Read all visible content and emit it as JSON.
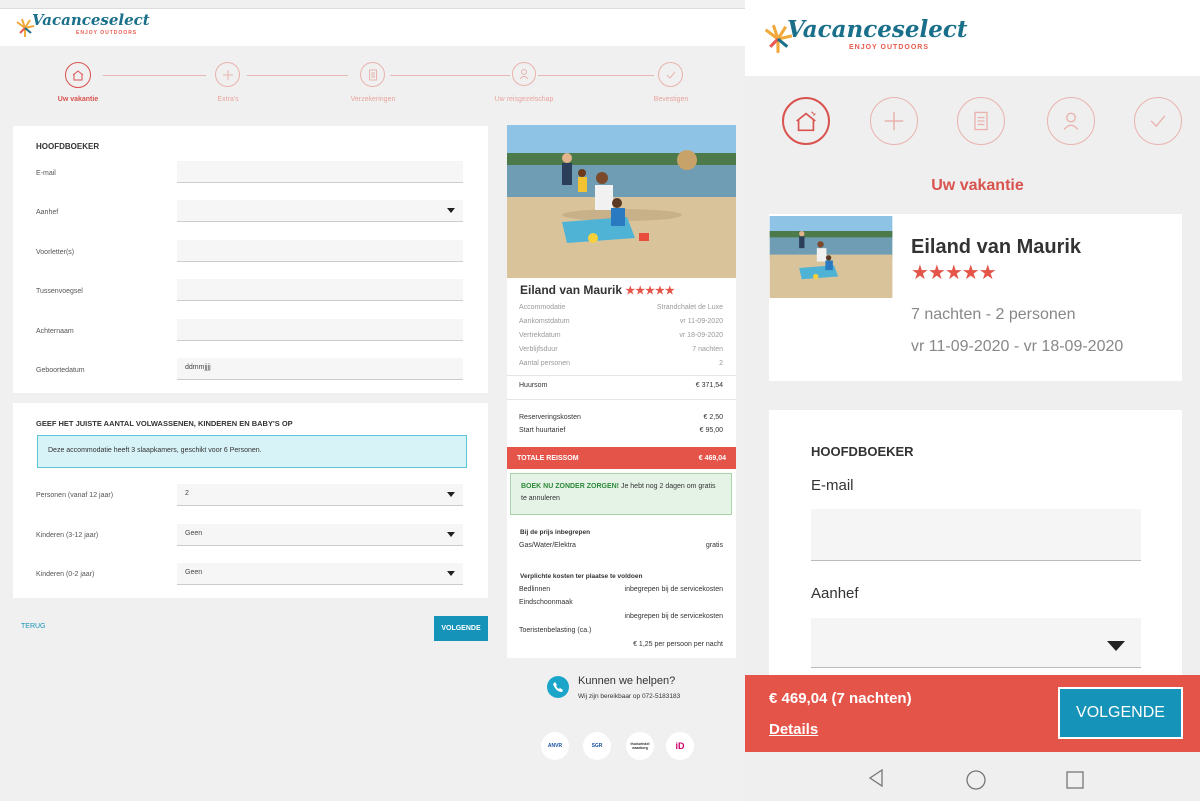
{
  "brand": {
    "name": "Vacanceselect",
    "tagline": "ENJOY OUTDOORS"
  },
  "steps": [
    {
      "label": "Uw vakantie",
      "icon": "house-icon",
      "active": true
    },
    {
      "label": "Extra's",
      "icon": "plus-icon",
      "active": false
    },
    {
      "label": "Verzekeringen",
      "icon": "document-icon",
      "active": false
    },
    {
      "label": "Uw reisgezelschap",
      "icon": "person-icon",
      "active": false
    },
    {
      "label": "Bevestigen",
      "icon": "checkmark-icon",
      "active": false
    }
  ],
  "form": {
    "title": "HOOFDBOEKER",
    "fields": [
      {
        "label": "E-mail",
        "value": ""
      },
      {
        "label": "Aanhef",
        "value": "",
        "type": "select"
      },
      {
        "label": "Voorletter(s)",
        "value": ""
      },
      {
        "label": "Tussenvoegsel",
        "value": ""
      },
      {
        "label": "Achternaam",
        "value": ""
      },
      {
        "label": "Geboortedatum",
        "value": "ddmmjjjj"
      }
    ]
  },
  "guests": {
    "title": "GEEF HET JUISTE AANTAL VOLWASSENEN, KINDEREN EN BABY'S OP",
    "info": "Deze accommodatie heeft 3 slaapkamers, geschikt voor 6 Personen.",
    "rows": [
      {
        "label": "Personen (vanaf 12 jaar)",
        "value": "2"
      },
      {
        "label": "Kinderen (3-12 jaar)",
        "value": "Geen"
      },
      {
        "label": "Kinderen (0-2 jaar)",
        "value": "Geen"
      }
    ]
  },
  "nav": {
    "back": "TERUG",
    "next": "VOLGENDE"
  },
  "summary": {
    "park": "Eiland van Maurik",
    "stars": "★★★★★",
    "details": [
      {
        "label": "Accommodatie",
        "value": "Strandchalet de Luxe"
      },
      {
        "label": "Aankomstdatum",
        "value": "vr 11-09-2020"
      },
      {
        "label": "Vertrekdatum",
        "value": "vr 18-09-2020"
      },
      {
        "label": "Verblijfsduur",
        "value": "7 nachten"
      },
      {
        "label": "Aantal personen",
        "value": "2"
      }
    ],
    "huursom": {
      "label": "Huursom",
      "value": "€ 371,54"
    },
    "costs": [
      {
        "label": "Reserveringskosten",
        "value": "€ 2,50"
      },
      {
        "label": "Start huurtarief",
        "value": "€ 95,00"
      }
    ],
    "total": {
      "label": "TOTALE REISSOM",
      "value": "€ 469,04"
    },
    "promo_bold": "BOEK NU ZONDER ZORGEN!",
    "promo_text": " Je hebt nog 2 dagen om gratis te annuleren",
    "included_title": "Bij de prijs inbegrepen",
    "included": {
      "label": "Gas/Water/Elektra",
      "value": "gratis"
    },
    "mandatory_title": "Verplichte kosten ter plaatse te voldoen",
    "mandatory": [
      {
        "label": "Bedlinnen",
        "value": "inbegrepen bij de servicekosten"
      },
      {
        "label": "Eindschoonmaak",
        "value": "inbegrepen bij de servicekosten"
      },
      {
        "label": "Toeristenbelasting (ca.)",
        "value": "€ 1,25 per persoon per nacht"
      }
    ]
  },
  "help": {
    "title": "Kunnen we helpen?",
    "text": "Wij zijn bereikbaar op 072-5183183"
  },
  "payment_logos": [
    "ANVR",
    "SGR",
    "thuiswinkel waarborg",
    "iD"
  ],
  "mobile": {
    "active_step": "Uw vakantie",
    "park": "Eiland van Maurik",
    "stars": "★★★★★",
    "nights_persons": "7 nachten - 2 personen",
    "dates": "vr 11-09-2020 - vr 18-09-2020",
    "form_title": "HOOFDBOEKER",
    "field1": "E-mail",
    "field2": "Aanhef",
    "footer_price": "€ 469,04 (7 nachten)",
    "footer_details": "Details",
    "next": "VOLGENDE"
  },
  "colors": {
    "accent": "#e55449",
    "teal": "#1593b8",
    "brand_blue": "#1a6f8a"
  }
}
